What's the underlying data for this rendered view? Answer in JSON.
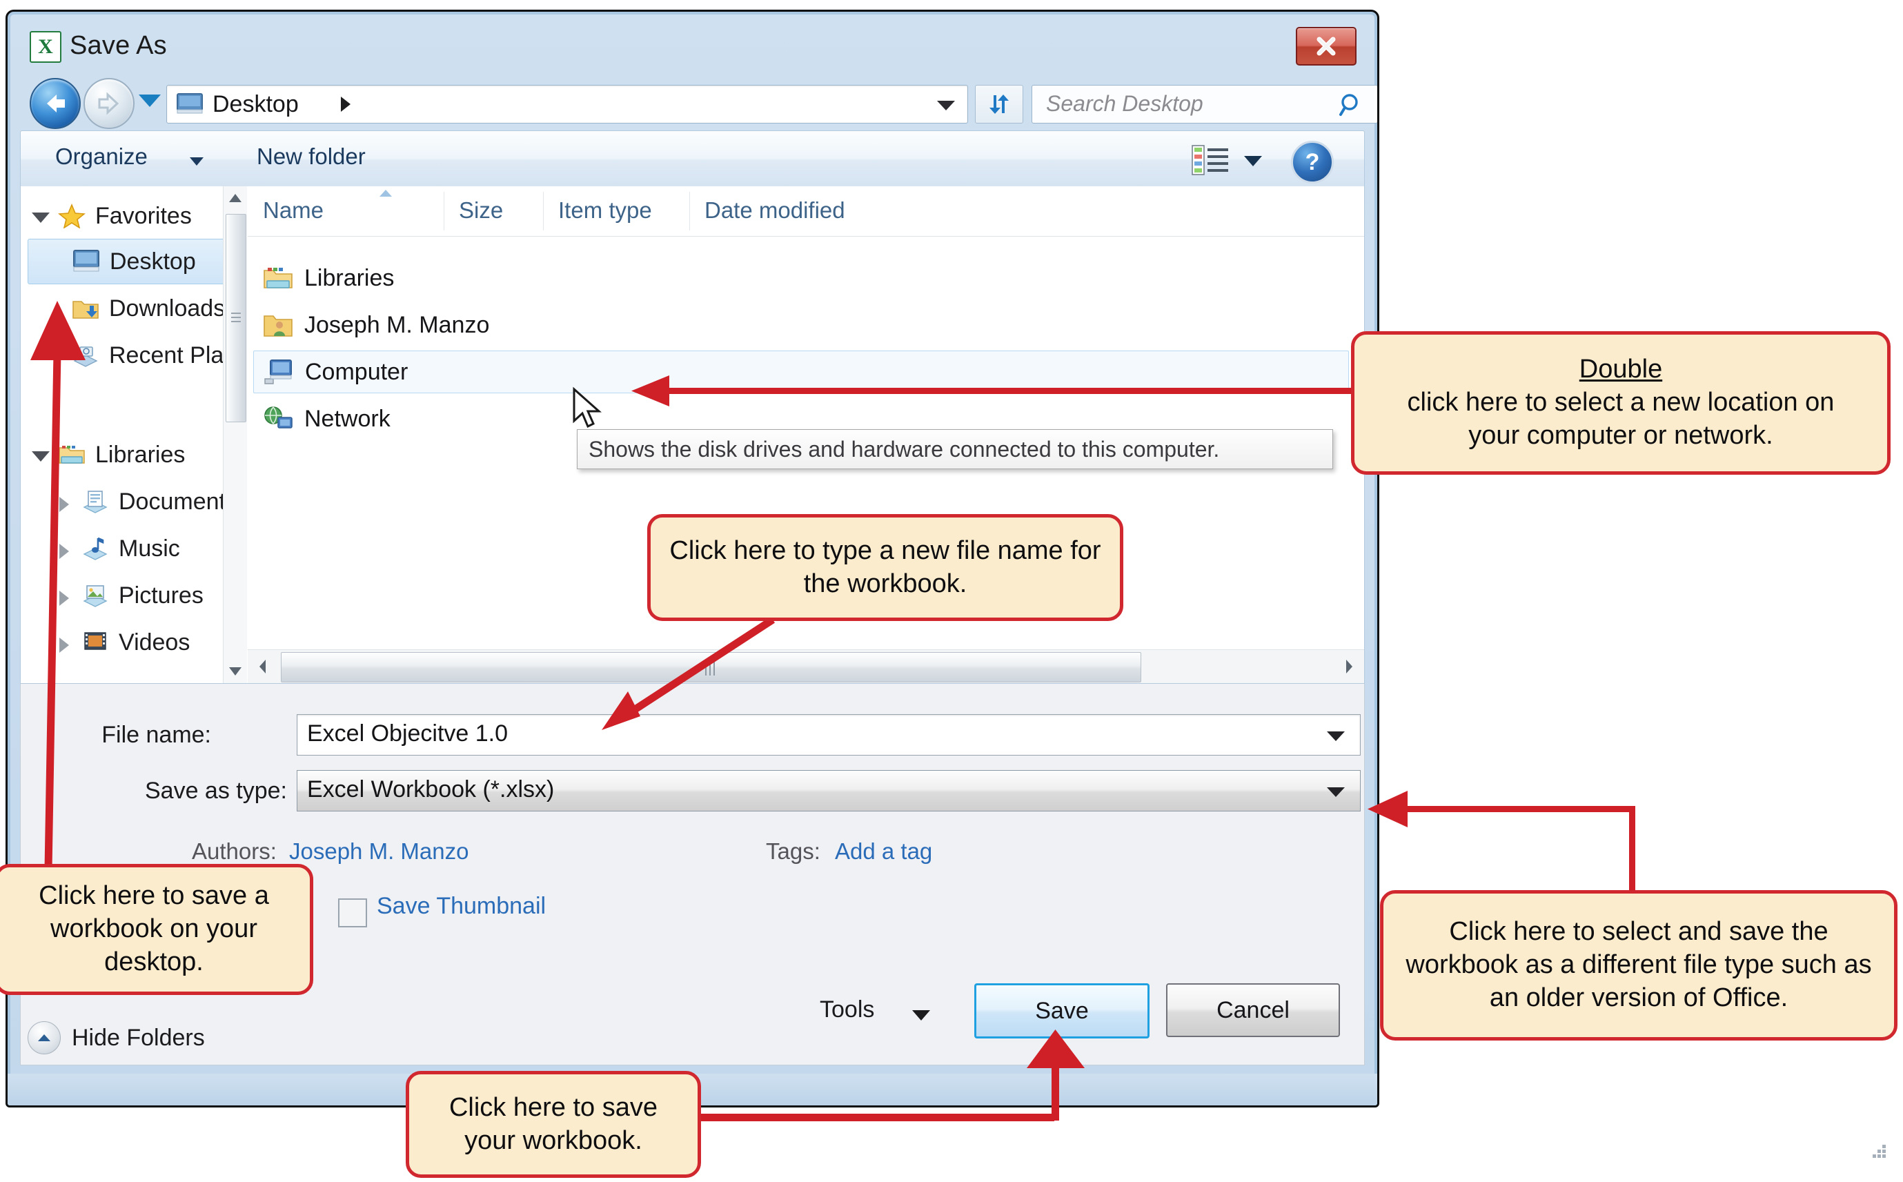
{
  "window": {
    "title": "Save As",
    "app_icon": "excel-icon",
    "close_label": "Close"
  },
  "nav": {
    "back_tooltip": "Back",
    "forward_tooltip": "Forward",
    "recent_locations": "Recent pages",
    "address_path": "Desktop",
    "refresh": "Refresh",
    "search_placeholder": "Search Desktop"
  },
  "commandbar": {
    "organize": "Organize",
    "new_folder": "New folder",
    "views": "Change your view",
    "help": "?"
  },
  "navpane": {
    "items": [
      {
        "label": "Favorites",
        "icon": "star-icon",
        "indent": 0,
        "expander": "open",
        "selected": false
      },
      {
        "label": "Desktop",
        "icon": "desktop-icon",
        "indent": 1,
        "expander": "none",
        "selected": true
      },
      {
        "label": "Downloads",
        "icon": "downloads-icon",
        "indent": 1,
        "expander": "none",
        "selected": false
      },
      {
        "label": "Recent Places",
        "icon": "recent-places-icon",
        "indent": 1,
        "expander": "none",
        "selected": false
      },
      {
        "label": "Libraries",
        "icon": "libraries-icon",
        "indent": 0,
        "expander": "open",
        "selected": false
      },
      {
        "label": "Documents",
        "icon": "documents-icon",
        "indent": 1,
        "expander": "closed",
        "selected": false
      },
      {
        "label": "Music",
        "icon": "music-icon",
        "indent": 1,
        "expander": "closed",
        "selected": false
      },
      {
        "label": "Pictures",
        "icon": "pictures-icon",
        "indent": 1,
        "expander": "closed",
        "selected": false
      },
      {
        "label": "Videos",
        "icon": "videos-icon",
        "indent": 1,
        "expander": "closed",
        "selected": false
      }
    ]
  },
  "filelist": {
    "columns": [
      "Name",
      "Size",
      "Item type",
      "Date modified"
    ],
    "sort_column": "Name",
    "rows": [
      {
        "name": "Libraries",
        "icon": "libraries-icon",
        "size": "",
        "item_type": "",
        "date_modified": "",
        "selected": false
      },
      {
        "name": "Joseph M. Manzo",
        "icon": "user-folder-icon",
        "size": "",
        "item_type": "",
        "date_modified": "",
        "selected": false
      },
      {
        "name": "Computer",
        "icon": "computer-icon",
        "size": "",
        "item_type": "",
        "date_modified": "",
        "selected": true
      },
      {
        "name": "Network",
        "icon": "network-icon",
        "size": "",
        "item_type": "",
        "date_modified": "",
        "selected": false
      }
    ],
    "tooltip": "Shows the disk drives and hardware connected to this computer."
  },
  "form": {
    "file_name_label": "File name:",
    "file_name_value": "Excel Objecitve 1.0",
    "save_as_type_label": "Save as type:",
    "save_as_type_value": "Excel Workbook (*.xlsx)",
    "authors_label": "Authors:",
    "authors_value": "Joseph M. Manzo",
    "tags_label": "Tags:",
    "tags_value": "Add a tag",
    "save_thumbnail_label": "Save Thumbnail",
    "save_thumbnail_checked": false,
    "tools_label": "Tools",
    "save_button": "Save",
    "cancel_button": "Cancel",
    "hide_folders_label": "Hide Folders"
  },
  "callouts": {
    "location": {
      "emphasis": "Double",
      "rest": " click here to select a new location on your computer or network."
    },
    "filename": "Click here to type a new file name for the workbook.",
    "desktop": "Click here to save a workbook on your desktop.",
    "filetype": "Click here to select and save the workbook as a different file type such as an older version of Office.",
    "save": "Click here to save your workbook."
  },
  "colors": {
    "callout_fill": "#fbeccd",
    "callout_border": "#d0282e",
    "arrow_red": "#cf2027",
    "accent_blue": "#1fa0e0",
    "link_blue": "#2b6cb9",
    "header_blue": "#3d6389"
  }
}
